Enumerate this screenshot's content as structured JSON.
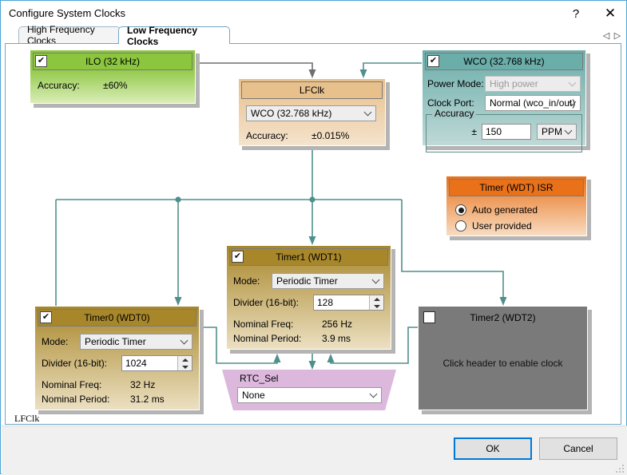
{
  "window": {
    "title": "Configure System Clocks",
    "help_label": "?",
    "close_label": "✕"
  },
  "tabs": {
    "items": [
      {
        "label": "High Frequency Clocks",
        "active": false
      },
      {
        "label": "Low Frequency Clocks",
        "active": true
      }
    ],
    "scroll_left": "◁",
    "scroll_right": "▷"
  },
  "blocks": {
    "ilo": {
      "title": "ILO (32 kHz)",
      "checked": "✔",
      "accuracy_label": "Accuracy:",
      "accuracy_value": "±60%"
    },
    "lfclk": {
      "title": "LFClk",
      "source_value": "WCO (32.768 kHz)",
      "accuracy_label": "Accuracy:",
      "accuracy_value": "±0.015%"
    },
    "wco": {
      "title": "WCO (32.768 kHz)",
      "checked": "✔",
      "power_mode_label": "Power Mode:",
      "power_mode_value": "High power",
      "clock_port_label": "Clock Port:",
      "clock_port_value": "Normal (wco_in/out)",
      "accuracy_group_label": "Accuracy",
      "plus_minus": "±",
      "accuracy_value": "150",
      "accuracy_unit": "PPM"
    },
    "isr": {
      "title": "Timer (WDT) ISR",
      "option_auto": "Auto generated",
      "option_user": "User provided",
      "selected": "auto"
    },
    "timer1": {
      "title": "Timer1 (WDT1)",
      "checked": "✔",
      "mode_label": "Mode:",
      "mode_value": "Periodic Timer",
      "divider_label": "Divider (16-bit):",
      "divider_value": "128",
      "nominal_freq_label": "Nominal Freq:",
      "nominal_freq_value": "256  Hz",
      "nominal_period_label": "Nominal Period:",
      "nominal_period_value": "3.9 ms"
    },
    "timer0": {
      "title": "Timer0 (WDT0)",
      "checked": "✔",
      "mode_label": "Mode:",
      "mode_value": "Periodic Timer",
      "divider_label": "Divider (16-bit):",
      "divider_value": "1024",
      "nominal_freq_label": "Nominal Freq:",
      "nominal_freq_value": "32  Hz",
      "nominal_period_label": "Nominal Period:",
      "nominal_period_value": "31.2 ms"
    },
    "timer2": {
      "title": "Timer2 (WDT2)",
      "checked": "",
      "message": "Click header to enable clock"
    },
    "rtc_sel": {
      "title": "RTC_Sel",
      "value": "None"
    },
    "lfclk_output_label": "LFClk"
  },
  "footer": {
    "ok_label": "OK",
    "cancel_label": "Cancel"
  },
  "colors": {
    "wire_active": "#4f8f8c",
    "wire_inactive": "#6f6f6f",
    "ilo_green": "#8cc63f",
    "lfclk_tan": "#e8c08c",
    "wco_teal": "#6aada9",
    "isr_orange": "#e8711a",
    "timer_gold": "#a8872b",
    "disabled_gray": "#7a7a7a",
    "rtc_violet": "#dcb8dc",
    "accent_blue": "#0078d7"
  }
}
